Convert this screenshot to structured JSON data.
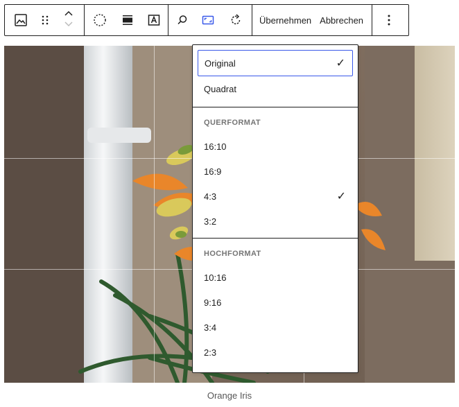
{
  "toolbar": {
    "icons": [
      "image-icon",
      "drag-handle-icon",
      "move-up-down-icon",
      "duotone-icon",
      "align-icon",
      "text-overlay-icon",
      "search-icon",
      "aspect-ratio-icon",
      "rotate-icon",
      "more-options-icon"
    ],
    "apply_label": "Übernehmen",
    "cancel_label": "Abbrechen",
    "aspect_ratio_active_color": "#3858e9"
  },
  "caption": "Orange Iris",
  "aspect_menu": {
    "top_items": [
      {
        "label": "Original",
        "checked": true,
        "focused": true
      },
      {
        "label": "Quadrat",
        "checked": false
      }
    ],
    "landscape": {
      "heading": "Querformat",
      "items": [
        {
          "label": "16:10",
          "checked": false
        },
        {
          "label": "16:9",
          "checked": false
        },
        {
          "label": "4:3",
          "checked": true
        },
        {
          "label": "3:2",
          "checked": false
        }
      ]
    },
    "portrait": {
      "heading": "Hochformat",
      "items": [
        {
          "label": "10:16",
          "checked": false
        },
        {
          "label": "9:16",
          "checked": false
        },
        {
          "label": "3:4",
          "checked": false
        },
        {
          "label": "2:3",
          "checked": false
        }
      ]
    },
    "check_glyph": "✓"
  }
}
